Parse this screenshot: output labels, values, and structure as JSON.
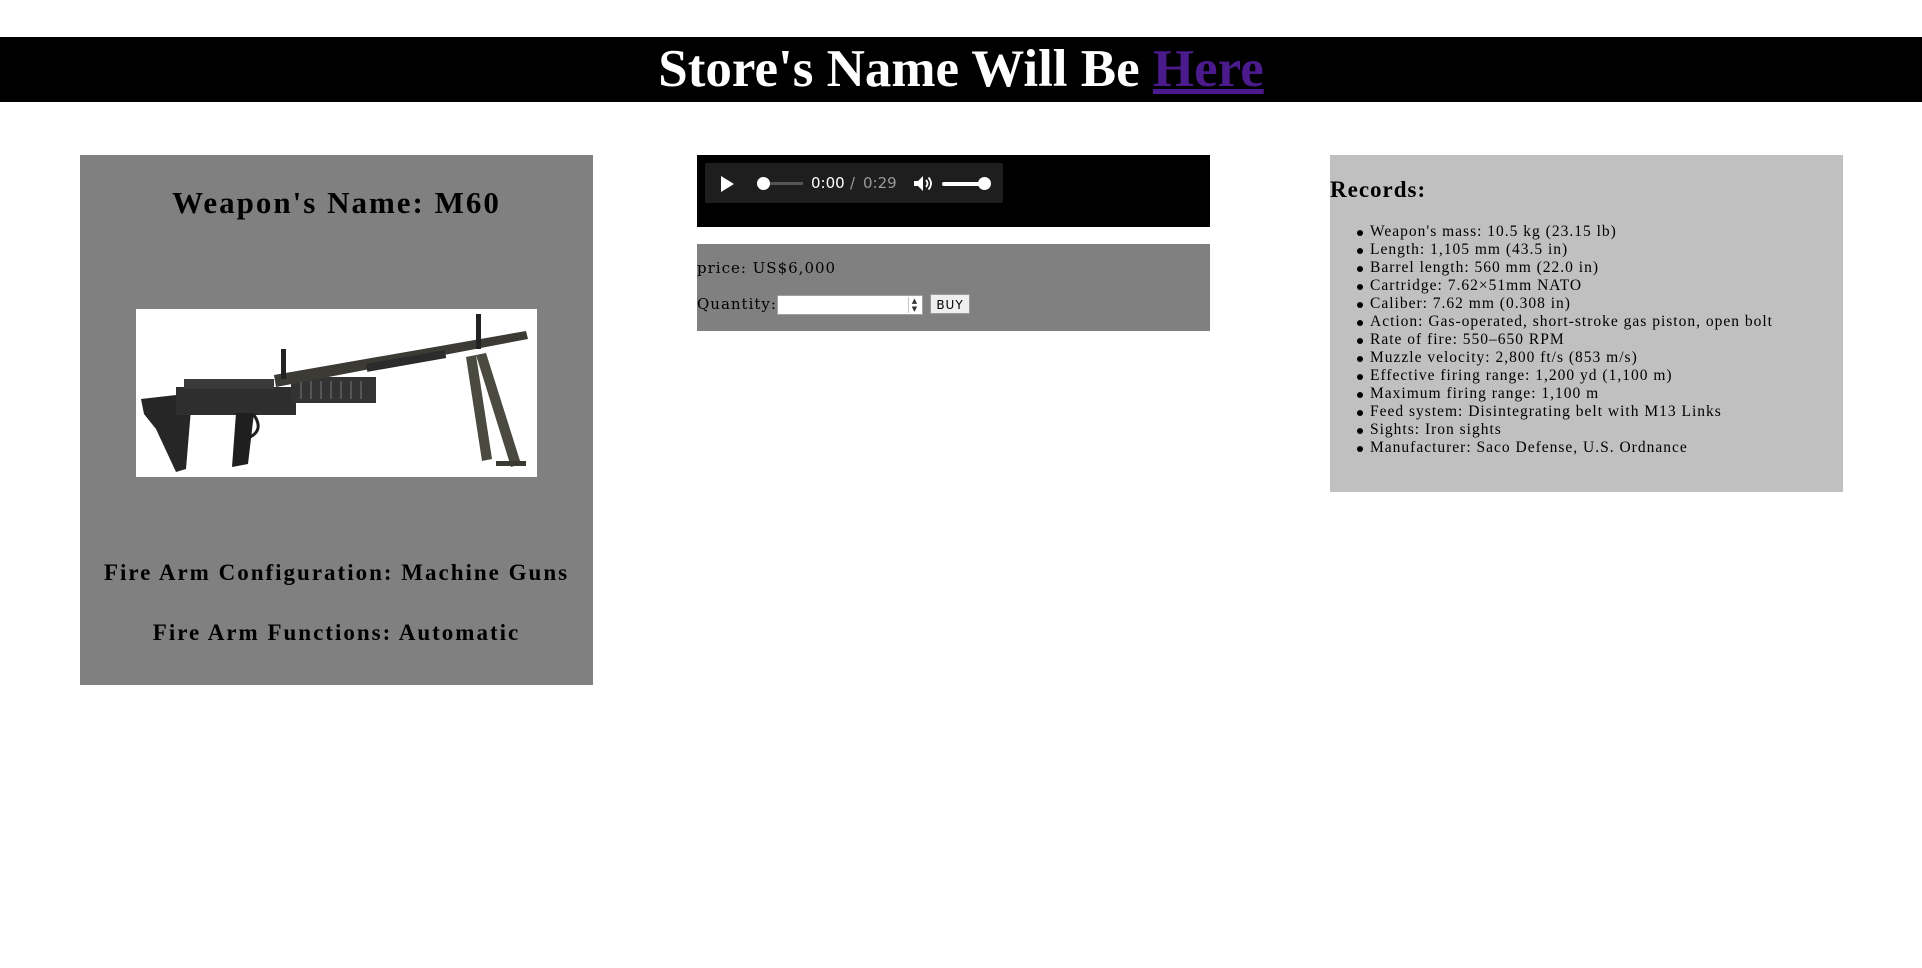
{
  "header": {
    "title_prefix": "Store's Name Will Be ",
    "title_link": "Here"
  },
  "weapon": {
    "name": "Weapon's Name: M60",
    "configuration": "Fire Arm Configuration: Machine Guns",
    "functions": "Fire Arm Functions: Automatic"
  },
  "audio": {
    "current_time": "0:00",
    "separator": "/",
    "total_time": "0:29",
    "progress": 0,
    "volume": 1
  },
  "purchase": {
    "price": "price: US$6,000",
    "quantity_label": "Quantity:",
    "quantity_value": "",
    "buy_label": "BUY"
  },
  "records": {
    "title": "Records:",
    "items": [
      "Weapon's mass: 10.5 kg (23.15 lb)",
      "Length: 1,105 mm (43.5 in)",
      "Barrel length: 560 mm (22.0 in)",
      "Cartridge: 7.62×51mm NATO",
      "Caliber: 7.62 mm (0.308 in)",
      "Action: Gas-operated, short-stroke gas piston, open bolt",
      "Rate of fire: 550–650 RPM",
      "Muzzle velocity: 2,800 ft/s (853 m/s)",
      "Effective firing range: 1,200 yd (1,100 m)",
      "Maximum firing range: 1,100 m",
      "Feed system: Disintegrating belt with M13 Links",
      "Sights: Iron sights",
      "Manufacturer: Saco Defense, U.S. Ordnance"
    ]
  }
}
